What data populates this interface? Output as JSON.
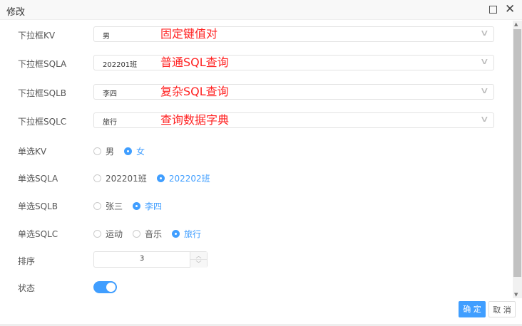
{
  "dialog": {
    "title": "修改"
  },
  "fields": {
    "selects": [
      {
        "label": "下拉框KV",
        "value": "男",
        "annotation": "固定键值对"
      },
      {
        "label": "下拉框SQLA",
        "value": "202201班",
        "annotation": "普通SQL查询"
      },
      {
        "label": "下拉框SQLB",
        "value": "李四",
        "annotation": "复杂SQL查询"
      },
      {
        "label": "下拉框SQLC",
        "value": "旅行",
        "annotation": "查询数据字典"
      }
    ],
    "radios": [
      {
        "label": "单选KV",
        "options": [
          "男",
          "女"
        ],
        "selected": 1
      },
      {
        "label": "单选SQLA",
        "options": [
          "202201班",
          "202202班"
        ],
        "selected": 1
      },
      {
        "label": "单选SQLB",
        "options": [
          "张三",
          "李四"
        ],
        "selected": 1
      },
      {
        "label": "单选SQLC",
        "options": [
          "运动",
          "音乐",
          "旅行"
        ],
        "selected": 2
      }
    ],
    "sort": {
      "label": "排序",
      "value": "3"
    },
    "status": {
      "label": "状态",
      "on": true
    }
  },
  "buttons": {
    "ok": "确 定",
    "cancel": "取 消"
  },
  "colors": {
    "primary": "#409eff",
    "annotation": "#ff2222"
  }
}
